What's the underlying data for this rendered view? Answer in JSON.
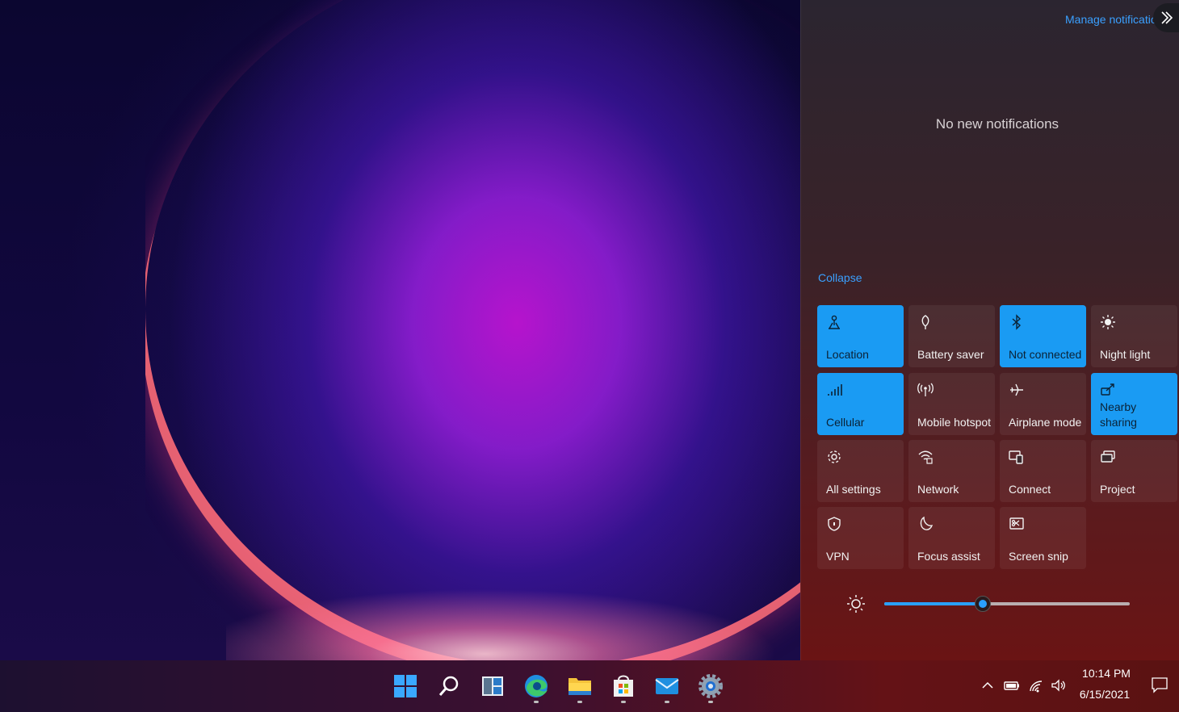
{
  "action_center": {
    "manage_link": "Manage notifications",
    "empty_message": "No new notifications",
    "collapse_label": "Collapse",
    "tiles": [
      {
        "label": "Location",
        "icon": "location-icon",
        "active": true
      },
      {
        "label": "Battery saver",
        "icon": "battery-saver-icon",
        "active": false
      },
      {
        "label": "Not connected",
        "icon": "bluetooth-icon",
        "active": true
      },
      {
        "label": "Night light",
        "icon": "night-light-icon",
        "active": false
      },
      {
        "label": "Cellular",
        "icon": "cellular-icon",
        "active": true
      },
      {
        "label": "Mobile hotspot",
        "icon": "hotspot-icon",
        "active": false
      },
      {
        "label": "Airplane mode",
        "icon": "airplane-icon",
        "active": false
      },
      {
        "label": "Nearby sharing",
        "icon": "nearby-sharing-icon",
        "active": true
      },
      {
        "label": "All settings",
        "icon": "gear-icon",
        "active": false
      },
      {
        "label": "Network",
        "icon": "network-icon",
        "active": false
      },
      {
        "label": "Connect",
        "icon": "connect-icon",
        "active": false
      },
      {
        "label": "Project",
        "icon": "project-icon",
        "active": false
      },
      {
        "label": "VPN",
        "icon": "vpn-icon",
        "active": false
      },
      {
        "label": "Focus assist",
        "icon": "focus-assist-icon",
        "active": false
      },
      {
        "label": "Screen snip",
        "icon": "screen-snip-icon",
        "active": false
      }
    ],
    "brightness": 0.4,
    "accent_color": "#1a9bf3"
  },
  "taskbar": {
    "apps": [
      "start-icon",
      "search-icon",
      "task-view-icon",
      "edge-icon",
      "file-explorer-icon",
      "store-icon",
      "mail-icon",
      "settings-icon"
    ],
    "tray": [
      "chevron-up-icon",
      "battery-icon",
      "wifi-icon",
      "volume-icon"
    ],
    "time": "10:14 PM",
    "date": "6/15/2021"
  }
}
